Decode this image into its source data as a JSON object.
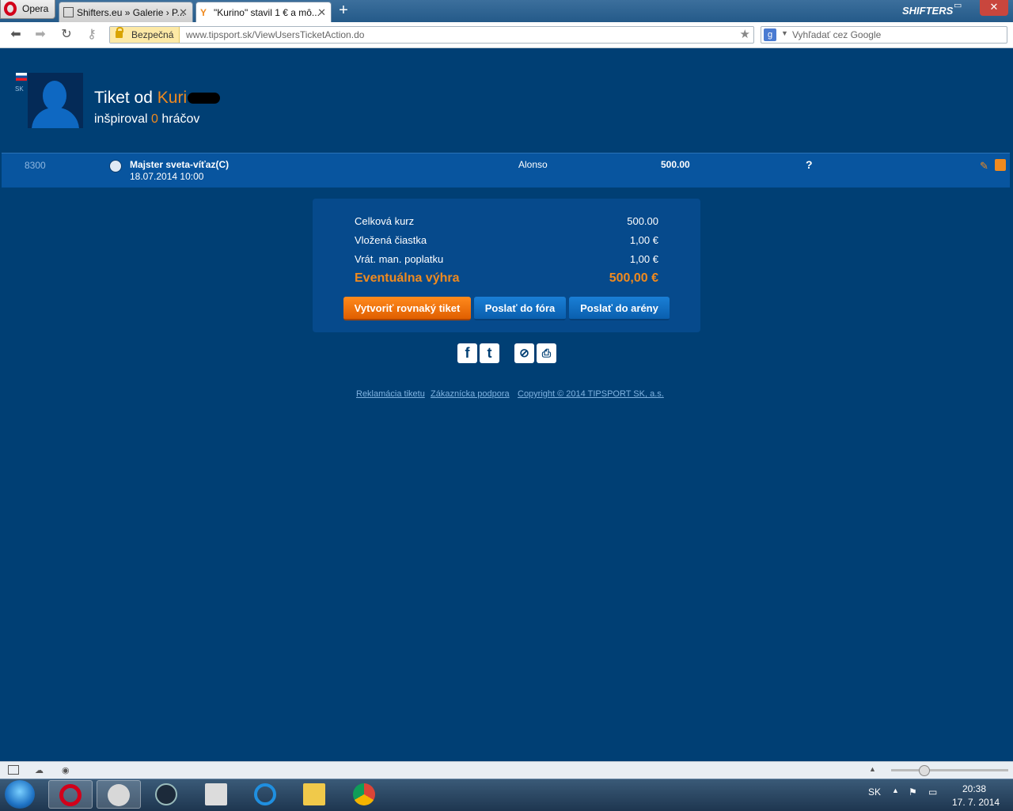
{
  "browser": {
    "menu_label": "Opera",
    "tabs": [
      {
        "title": "Shifters.eu » Galerie › P..."
      },
      {
        "title": "\"Kurino\" stavil 1 € a mô..."
      }
    ],
    "security_label": "Bezpečná",
    "url": "www.tipsport.sk/ViewUsersTicketAction.do",
    "search_placeholder": "Vyhľadať cez Google",
    "corner_watermark": "SHIFTERS"
  },
  "profile": {
    "title_prefix": "Tiket od",
    "user_name": "Kuri",
    "country_label": "SK",
    "inspired_prefix": "inšpiroval",
    "inspired_count": "0",
    "inspired_suffix": "hráčov"
  },
  "bet": {
    "id": "8300",
    "event": "Majster sveta-víťaz(C)",
    "datetime": "18.07.2014 10:00",
    "tip": "Alonso",
    "odds": "500.00",
    "result": "?"
  },
  "summary": {
    "total_odds_label": "Celková kurz",
    "total_odds_value": "500.00",
    "stake_label": "Vložená čiastka",
    "stake_value": "1,00 €",
    "fee_label": "Vrát. man. poplatku",
    "fee_value": "1,00 €",
    "win_label": "Eventuálna výhra",
    "win_value": "500,00 €"
  },
  "actions": {
    "copy_ticket": "Vytvoriť rovnaký tiket",
    "send_forum": "Poslať do fóra",
    "send_arena": "Poslať do arény"
  },
  "footer": {
    "complaint": "Reklamácia tiketu",
    "support": "Zákaznícka podpora",
    "copyright": "Copyright © 2014 TIPSPORT SK, a.s."
  },
  "taskbar": {
    "language": "SK",
    "time": "20:38",
    "date": "17. 7. 2014"
  },
  "colors": {
    "page_bg": "#003f74",
    "accent_orange": "#f08a1e",
    "row_bg": "#08559f"
  }
}
